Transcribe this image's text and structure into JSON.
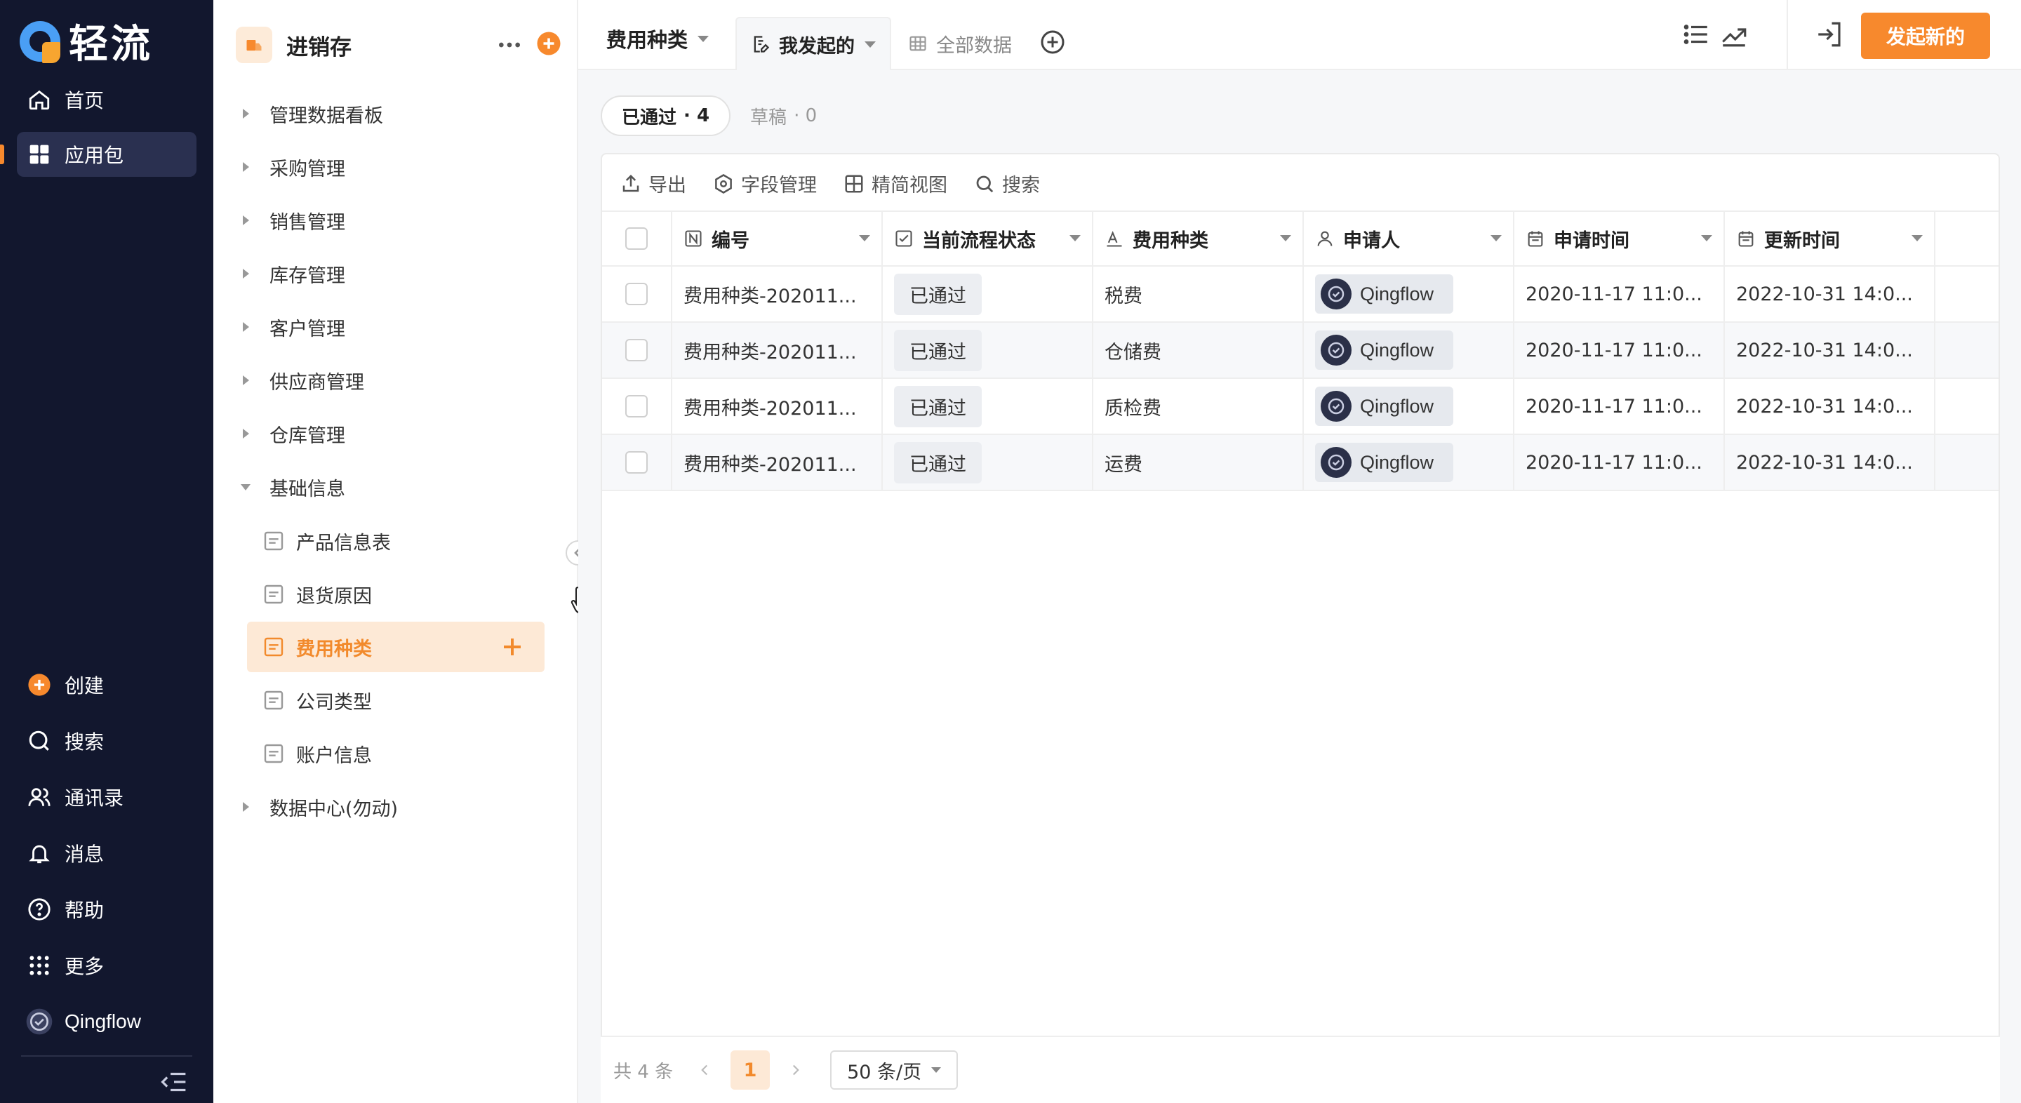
{
  "brand": {
    "name": "轻流"
  },
  "nav": {
    "top": [
      {
        "label": "首页",
        "icon": "home-icon"
      },
      {
        "label": "应用包",
        "icon": "apps-icon",
        "active": true
      }
    ],
    "bottom": [
      {
        "label": "创建",
        "icon": "plus-circle-icon"
      },
      {
        "label": "搜索",
        "icon": "search-icon"
      },
      {
        "label": "通讯录",
        "icon": "contacts-icon"
      },
      {
        "label": "消息",
        "icon": "bell-icon"
      },
      {
        "label": "帮助",
        "icon": "help-icon"
      },
      {
        "label": "更多",
        "icon": "grid-dots-icon"
      }
    ],
    "user": "Qingflow"
  },
  "sidebar": {
    "app_title": "进销存",
    "groups": [
      {
        "label": "管理数据看板",
        "expanded": false
      },
      {
        "label": "采购管理",
        "expanded": false
      },
      {
        "label": "销售管理",
        "expanded": false
      },
      {
        "label": "库存管理",
        "expanded": false
      },
      {
        "label": "客户管理",
        "expanded": false
      },
      {
        "label": "供应商管理",
        "expanded": false
      },
      {
        "label": "仓库管理",
        "expanded": false
      },
      {
        "label": "基础信息",
        "expanded": true
      }
    ],
    "sub_items": [
      {
        "label": "产品信息表"
      },
      {
        "label": "退货原因"
      },
      {
        "label": "费用种类",
        "active": true
      },
      {
        "label": "公司类型"
      },
      {
        "label": "账户信息"
      }
    ],
    "last_group": {
      "label": "数据中心(勿动)"
    }
  },
  "topbar": {
    "view_name": "费用种类",
    "tabs": [
      {
        "label": "我发起的",
        "active": true
      },
      {
        "label": "全部数据",
        "active": false
      }
    ],
    "start_button": "发起新的"
  },
  "filters": [
    {
      "label": "已通过",
      "count": "· 4",
      "active": true
    },
    {
      "label": "草稿",
      "count": "· 0",
      "active": false
    }
  ],
  "toolbar": {
    "export": "导出",
    "fields": "字段管理",
    "compact": "精简视图",
    "search": "搜索"
  },
  "table": {
    "columns": [
      {
        "label": "编号",
        "icon": "number-field-icon"
      },
      {
        "label": "当前流程状态",
        "icon": "status-field-icon"
      },
      {
        "label": "费用种类",
        "icon": "text-field-icon"
      },
      {
        "label": "申请人",
        "icon": "person-field-icon"
      },
      {
        "label": "申请时间",
        "icon": "date-field-icon"
      },
      {
        "label": "更新时间",
        "icon": "date-field-icon"
      }
    ],
    "rows": [
      {
        "id": "费用种类-202011...",
        "status": "已通过",
        "type": "税费",
        "applicant": "Qingflow",
        "applied": "2020-11-17 11:0...",
        "updated": "2022-10-31 14:0..."
      },
      {
        "id": "费用种类-202011...",
        "status": "已通过",
        "type": "仓储费",
        "applicant": "Qingflow",
        "applied": "2020-11-17 11:0...",
        "updated": "2022-10-31 14:0..."
      },
      {
        "id": "费用种类-202011...",
        "status": "已通过",
        "type": "质检费",
        "applicant": "Qingflow",
        "applied": "2020-11-17 11:0...",
        "updated": "2022-10-31 14:0..."
      },
      {
        "id": "费用种类-202011...",
        "status": "已通过",
        "type": "运费",
        "applicant": "Qingflow",
        "applied": "2020-11-17 11:0...",
        "updated": "2022-10-31 14:0..."
      }
    ]
  },
  "pager": {
    "total": "共 4 条",
    "page": "1",
    "page_size": "50 条/页"
  },
  "colors": {
    "accent": "#f7892d",
    "nav_bg": "#12172e"
  }
}
